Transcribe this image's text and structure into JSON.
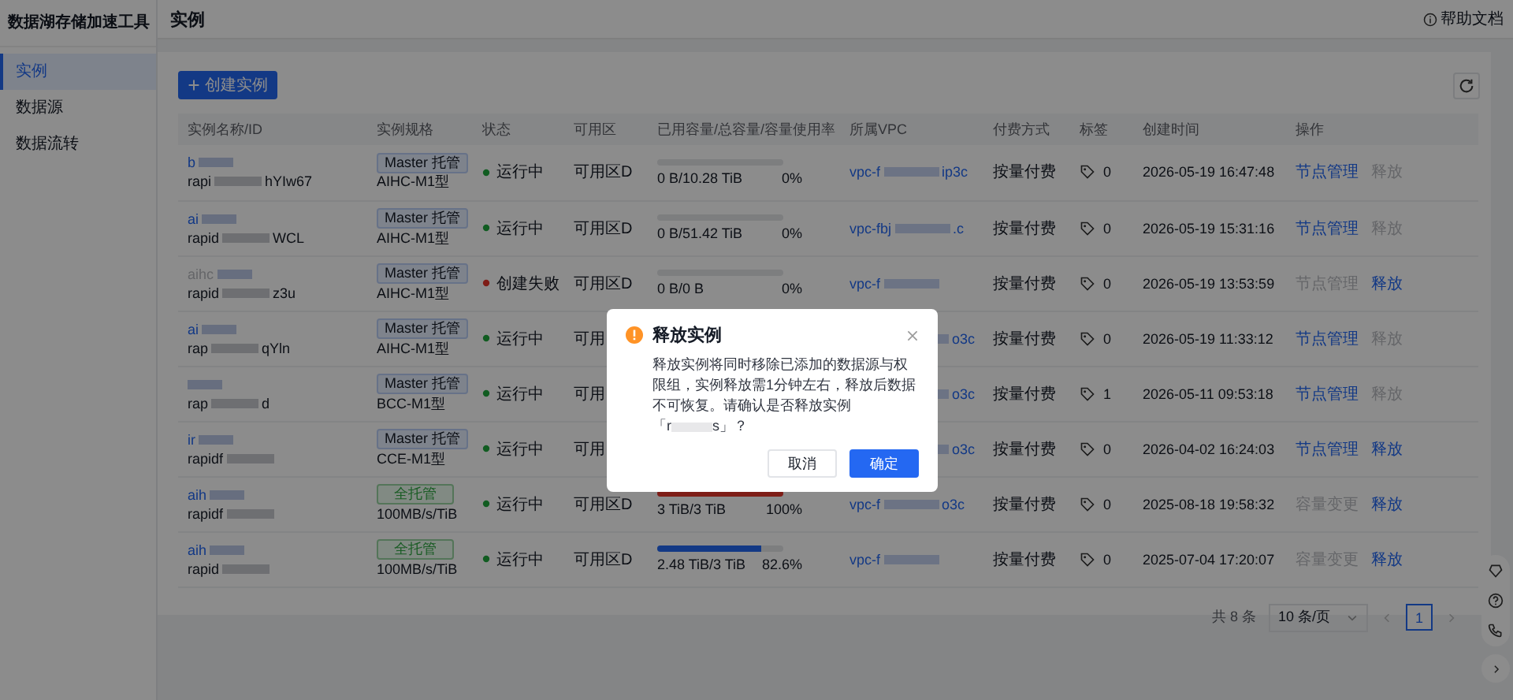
{
  "sidebar": {
    "title": "数据湖存储加速工具",
    "items": [
      {
        "label": "实例",
        "selected": true
      },
      {
        "label": "数据源",
        "selected": false
      },
      {
        "label": "数据流转",
        "selected": false
      }
    ]
  },
  "header": {
    "title": "实例",
    "help": "帮助文档"
  },
  "toolbar": {
    "create_button": "创建实例"
  },
  "table": {
    "columns": [
      "实例名称/ID",
      "实例规格",
      "状态",
      "可用区",
      "已用容量/总容量/容量使用率",
      "所属VPC",
      "付费方式",
      "标签",
      "创建时间",
      "操作"
    ],
    "rows": [
      {
        "name": "b",
        "id_start": "rapi",
        "id_end": "hYIw67",
        "spec_badge": {
          "label": "Master 托管",
          "kind": "master"
        },
        "spec": "AIHC-M1型",
        "status": {
          "label": "运行中",
          "kind": "running"
        },
        "zone": "可用区D",
        "usage": "0 B/10.28 TiB",
        "rate": "0%",
        "level": 0,
        "vpc_start": "vpc-f",
        "vpc_end": "ip3c",
        "billing": "按量付费",
        "tags": "0",
        "created": "2026-05-19 16:47:48",
        "actions": [
          {
            "label": "节点管理",
            "disabled": false
          },
          {
            "label": "释放",
            "disabled": true
          }
        ]
      },
      {
        "name": "ai",
        "id_start": "rapid",
        "id_end": "WCL",
        "spec_badge": {
          "label": "Master 托管",
          "kind": "master"
        },
        "spec": "AIHC-M1型",
        "status": {
          "label": "运行中",
          "kind": "running"
        },
        "zone": "可用区D",
        "usage": "0 B/51.42 TiB",
        "rate": "0%",
        "level": 0,
        "vpc_start": "vpc-fbj",
        "vpc_end": ".c",
        "billing": "按量付费",
        "tags": "0",
        "created": "2026-05-19 15:31:16",
        "actions": [
          {
            "label": "节点管理",
            "disabled": false
          },
          {
            "label": "释放",
            "disabled": true
          }
        ]
      },
      {
        "name": "aihc",
        "id_start": "rapid",
        "id_end": "z3u",
        "spec_badge": {
          "label": "Master 托管",
          "kind": "master"
        },
        "spec": "AIHC-M1型",
        "status": {
          "label": "创建失败",
          "kind": "failed"
        },
        "zone": "可用区D",
        "usage": "0 B/0 B",
        "rate": "0%",
        "level": 0,
        "vpc_start": "vpc-f",
        "billing": "按量付费",
        "tags": "0",
        "created": "2026-05-19 13:53:59",
        "actions": [
          {
            "label": "节点管理",
            "disabled": true
          },
          {
            "label": "释放",
            "disabled": false
          }
        ]
      },
      {
        "name": "ai",
        "id_start": "rap",
        "id_end": "qYln",
        "spec_badge": {
          "label": "Master 托管",
          "kind": "master"
        },
        "spec": "AIHC-M1型",
        "status": {
          "label": "运行中",
          "kind": "running"
        },
        "zone": "可用",
        "vpc_end": "o3c",
        "billing": "按量付费",
        "tags": "0",
        "created": "2026-05-19 11:33:12",
        "actions": [
          {
            "label": "节点管理",
            "disabled": false
          },
          {
            "label": "释放",
            "disabled": true
          }
        ]
      },
      {
        "id_start": "rap",
        "id_end": "d",
        "spec_badge": {
          "label": "Master 托管",
          "kind": "master"
        },
        "spec": "BCC-M1型",
        "status": {
          "label": "运行中",
          "kind": "running"
        },
        "zone": "可用",
        "vpc_end": "o3c",
        "billing": "按量付费",
        "tags": "1",
        "created": "2026-05-11 09:53:18",
        "actions": [
          {
            "label": "节点管理",
            "disabled": false
          },
          {
            "label": "释放",
            "disabled": true
          }
        ]
      },
      {
        "name": "ir",
        "id_start": "rapidf",
        "spec_badge": {
          "label": "Master 托管",
          "kind": "master"
        },
        "spec": "CCE-M1型",
        "status": {
          "label": "运行中",
          "kind": "running"
        },
        "zone": "可用",
        "vpc_end": "o3c",
        "billing": "按量付费",
        "tags": "0",
        "created": "2026-04-02 16:24:03",
        "actions": [
          {
            "label": "节点管理",
            "disabled": false
          },
          {
            "label": "释放",
            "disabled": false
          }
        ]
      },
      {
        "name": "aih",
        "id_start": "rapidf",
        "spec_badge": {
          "label": "全托管",
          "kind": "full"
        },
        "spec": "100MB/s/TiB",
        "status": {
          "label": "运行中",
          "kind": "running"
        },
        "zone": "可用区D",
        "usage": "3 TiB/3 TiB",
        "rate": "100%",
        "level": 1,
        "vpc_start": "vpc-f",
        "vpc_end": "o3c",
        "billing": "按量付费",
        "tags": "0",
        "created": "2025-08-18 19:58:32",
        "actions": [
          {
            "label": "容量变更",
            "disabled": true
          },
          {
            "label": "释放",
            "disabled": false
          }
        ]
      },
      {
        "name": "aih",
        "id_start": "rapid",
        "spec_badge": {
          "label": "全托管",
          "kind": "full"
        },
        "spec": "100MB/s/TiB",
        "status": {
          "label": "运行中",
          "kind": "running"
        },
        "zone": "可用区D",
        "usage": "2.48 TiB/3 TiB",
        "rate": "82.6%",
        "level": 0.826,
        "vpc_start": "vpc-f",
        "billing": "按量付费",
        "tags": "0",
        "created": "2025-07-04 17:20:07",
        "actions": [
          {
            "label": "容量变更",
            "disabled": true
          },
          {
            "label": "释放",
            "disabled": false
          }
        ]
      }
    ]
  },
  "pagination": {
    "total": "共 8 条",
    "page_size": "10 条/页",
    "pages": [
      {
        "label": "1",
        "selected": true
      }
    ]
  },
  "dialog": {
    "title": "释放实例",
    "body": "释放实例将同时移除已添加的数据源与权限组，实例释放需1分钟左右，释放后数据不可恢复。请确认是否释放实例",
    "instance_start": "「r",
    "instance_end": "s」？",
    "buttons": [
      {
        "label": "取消",
        "kind": "secondary"
      },
      {
        "label": "确定",
        "kind": "primary"
      }
    ]
  }
}
